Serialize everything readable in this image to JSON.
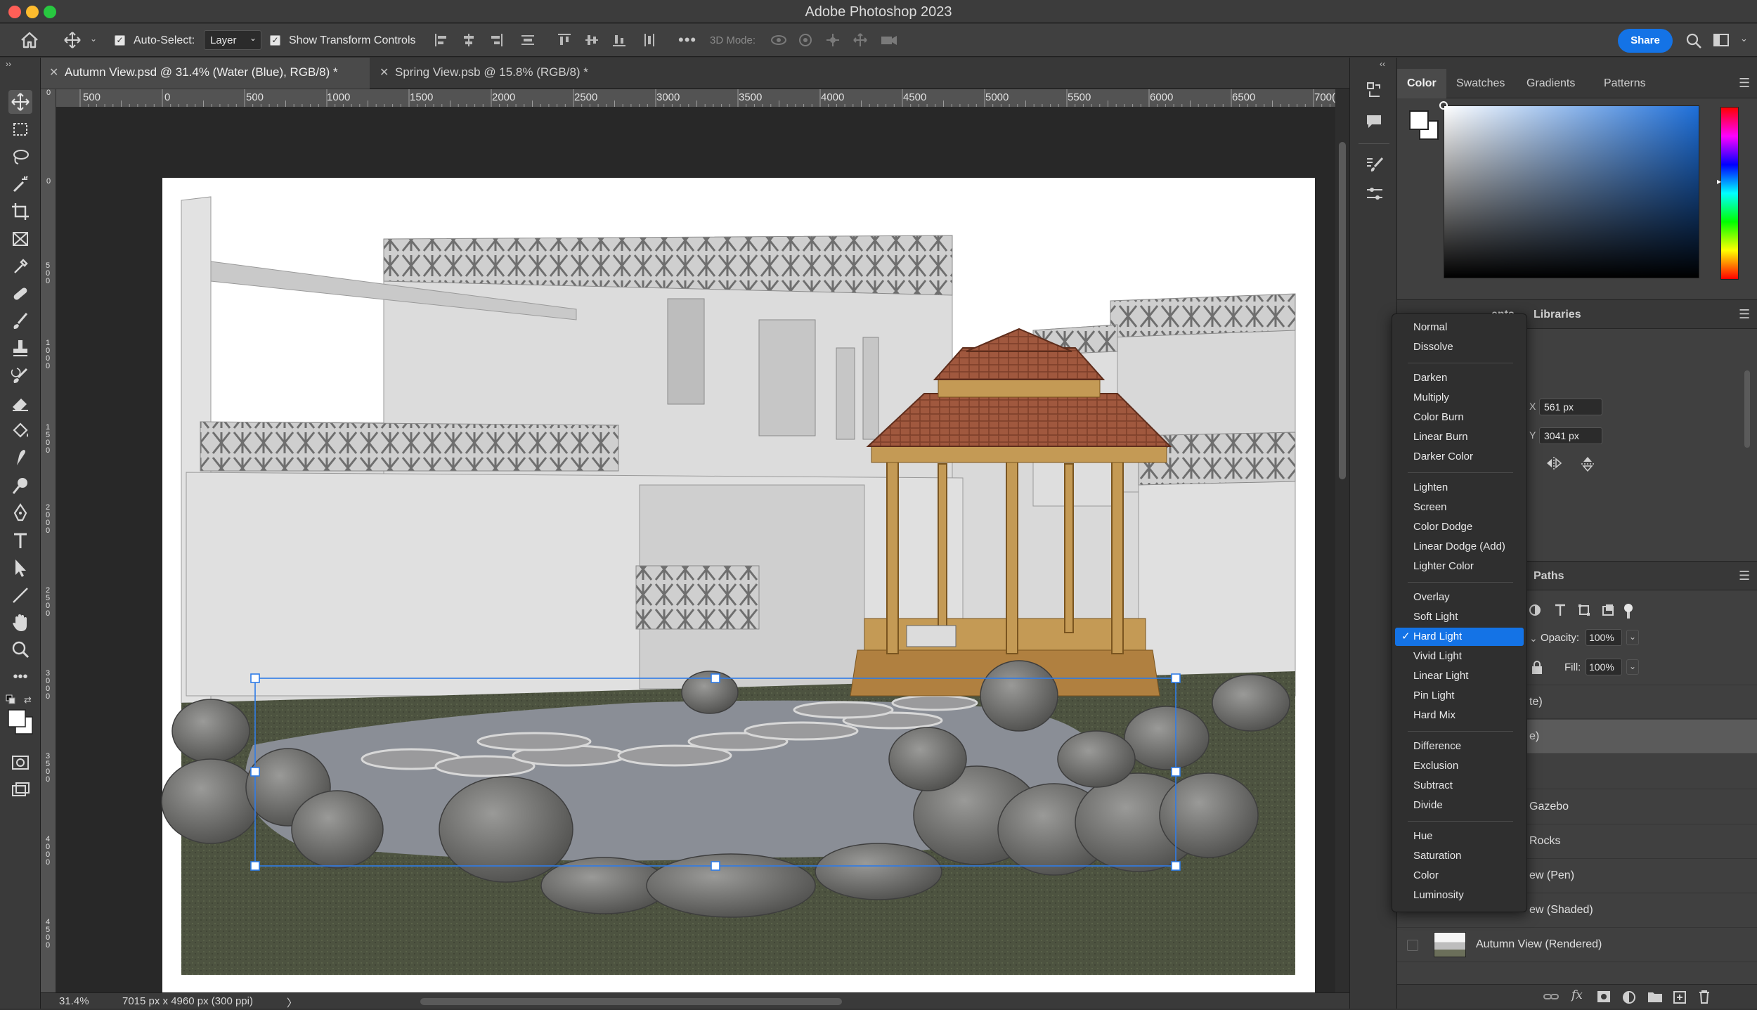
{
  "app": {
    "title": "Adobe Photoshop 2023"
  },
  "options_bar": {
    "auto_select_label": "Auto-Select:",
    "auto_select_checked": true,
    "auto_select_target": "Layer",
    "show_transform_label": "Show Transform Controls",
    "show_transform_checked": true,
    "mode_3d_label": "3D Mode:",
    "share_label": "Share"
  },
  "document_tabs": [
    {
      "label": "Autumn View.psd @ 31.4% (Water (Blue), RGB/8) *",
      "active": true
    },
    {
      "label": "Spring View.psb @ 15.8% (RGB/8) *",
      "active": false
    }
  ],
  "rulers": {
    "horizontal": [
      "500",
      "0",
      "500",
      "1000",
      "1500",
      "2000",
      "2500",
      "3000",
      "3500",
      "4000",
      "4500",
      "5000",
      "5500",
      "6000",
      "6500",
      "700("
    ],
    "vertical": [
      "0",
      "0",
      "5 0 0",
      "1 0 0 0",
      "1 5 0 0",
      "2 0 0 0",
      "2 5 0 0",
      "3 0 0 0",
      "3 5 0 0",
      "4 0 0 0",
      "4 5 0 0"
    ]
  },
  "status": {
    "zoom": "31.4%",
    "doc_size": "7015 px x 4960 px (300 ppi)",
    "arrow": "〉"
  },
  "color_panel": {
    "tabs": [
      "Color",
      "Swatches",
      "Gradients",
      "Patterns"
    ],
    "active_tab": "Color",
    "foreground": "#ffffff",
    "background": "#ffffff",
    "hue_color": "#1e6fd9"
  },
  "properties_panel": {
    "tabs_visible": [
      "ents",
      "Libraries"
    ],
    "x_label": "X",
    "x_value": "561 px",
    "y_label": "Y",
    "y_value": "3041 px"
  },
  "layers_panel": {
    "tab_visible": "Paths",
    "opacity_label": "Opacity:",
    "opacity_value": "100%",
    "fill_label": "Fill:",
    "fill_value": "100%",
    "rows": [
      {
        "label": "te)",
        "selected": false
      },
      {
        "label": "e)",
        "selected": true
      },
      {
        "label": "",
        "selected": false
      },
      {
        "label": "Gazebo",
        "selected": false
      },
      {
        "label": "Rocks",
        "selected": false
      },
      {
        "label": "ew (Pen)",
        "selected": false
      },
      {
        "label": "ew (Shaded)",
        "selected": false
      },
      {
        "label": "Autumn View (Rendered)",
        "selected": false
      }
    ]
  },
  "blend_menu": {
    "groups": [
      [
        "Normal",
        "Dissolve"
      ],
      [
        "Darken",
        "Multiply",
        "Color Burn",
        "Linear Burn",
        "Darker Color"
      ],
      [
        "Lighten",
        "Screen",
        "Color Dodge",
        "Linear Dodge (Add)",
        "Lighter Color"
      ],
      [
        "Overlay",
        "Soft Light",
        "Hard Light",
        "Vivid Light",
        "Linear Light",
        "Pin Light",
        "Hard Mix"
      ],
      [
        "Difference",
        "Exclusion",
        "Subtract",
        "Divide"
      ],
      [
        "Hue",
        "Saturation",
        "Color",
        "Luminosity"
      ]
    ],
    "selected": "Hard Light",
    "check_mark": "✓"
  },
  "colors": {
    "accent": "#1473e6",
    "panel": "#404040",
    "canvas_bg": "#282828"
  }
}
